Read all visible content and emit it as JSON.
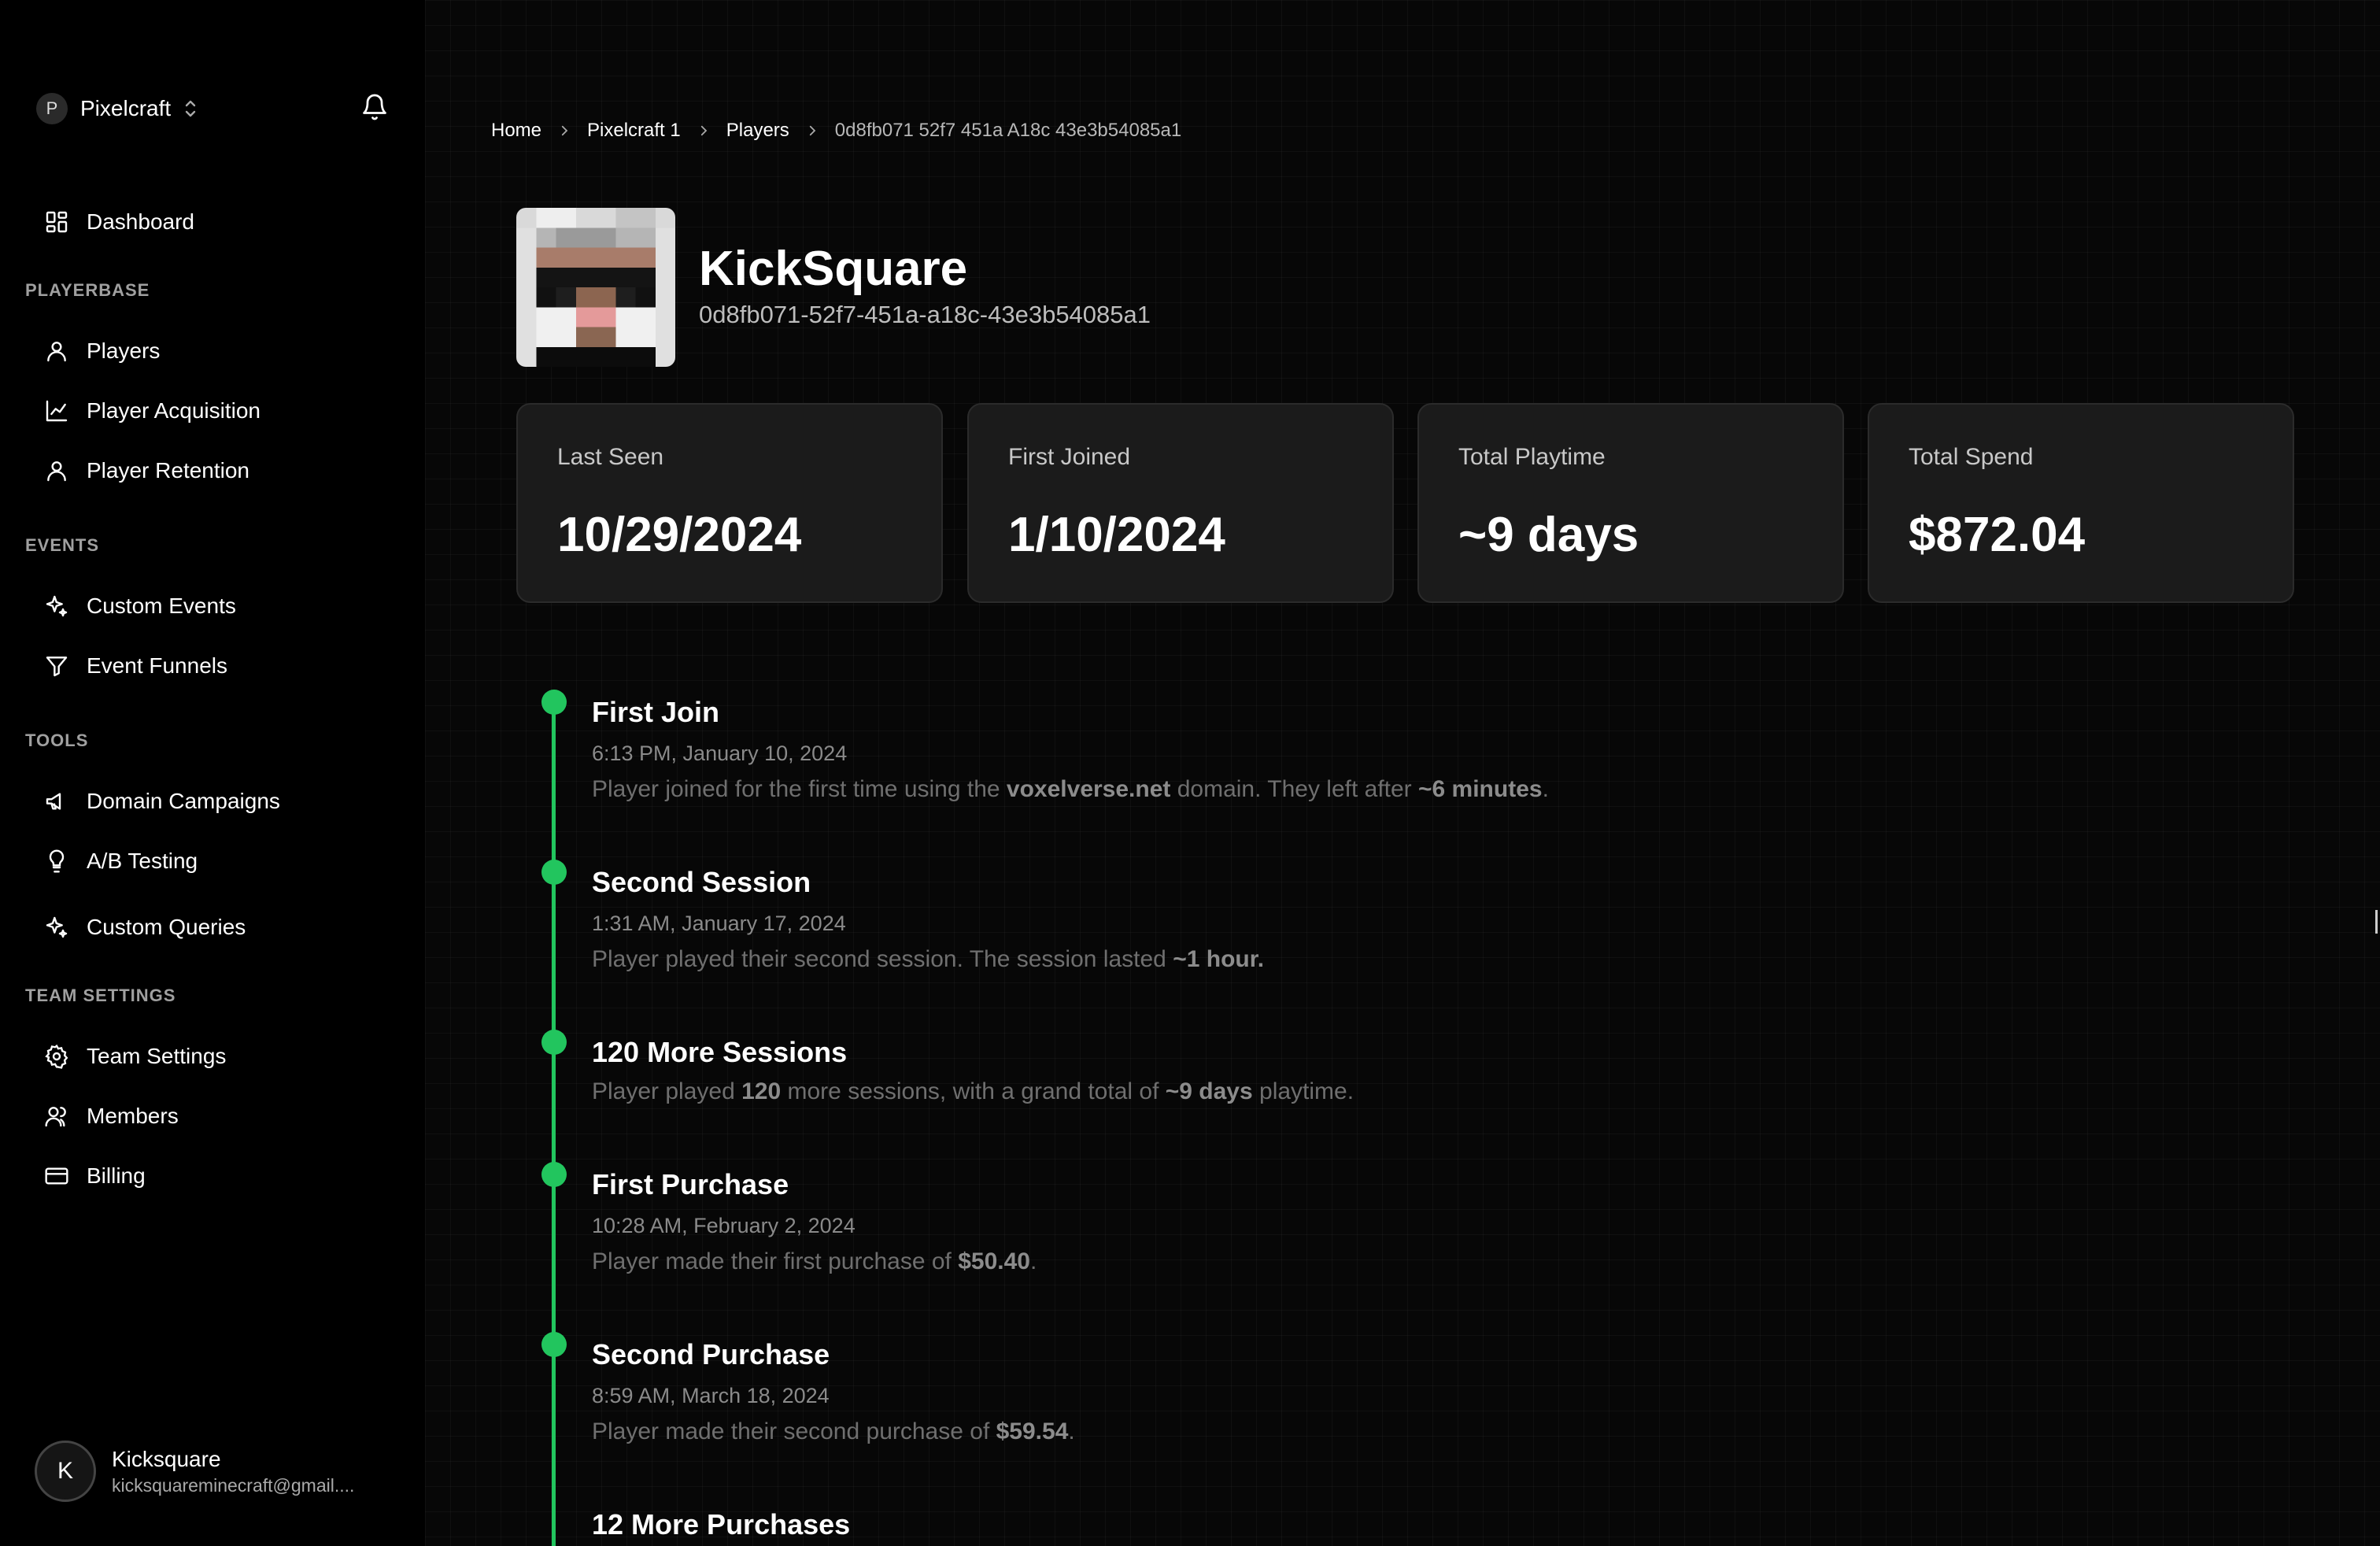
{
  "sidebar": {
    "team": {
      "initial": "P",
      "name": "Pixelcraft"
    },
    "dashboard": "Dashboard",
    "sections": {
      "playerbase": "PLAYERBASE",
      "events": "EVENTS",
      "tools": "TOOLS",
      "team_settings": "TEAM SETTINGS"
    },
    "items": {
      "players": "Players",
      "player_acquisition": "Player Acquisition",
      "player_retention": "Player Retention",
      "custom_events": "Custom Events",
      "event_funnels": "Event Funnels",
      "domain_campaigns": "Domain Campaigns",
      "ab_testing": "A/B Testing",
      "custom_queries": "Custom Queries",
      "team_settings": "Team Settings",
      "members": "Members",
      "billing": "Billing"
    },
    "user": {
      "initial": "K",
      "name": "Kicksquare",
      "email": "kicksquareminecraft@gmail...."
    }
  },
  "breadcrumb": [
    "Home",
    "Pixelcraft 1",
    "Players",
    "0d8fb071 52f7 451a A18c 43e3b54085a1"
  ],
  "player": {
    "name": "KickSquare",
    "uuid": "0d8fb071-52f7-451a-a18c-43e3b54085a1"
  },
  "stats": [
    {
      "label": "Last Seen",
      "value": "10/29/2024"
    },
    {
      "label": "First Joined",
      "value": "1/10/2024"
    },
    {
      "label": "Total Playtime",
      "value": "~9 days"
    },
    {
      "label": "Total Spend",
      "value": "$872.04"
    }
  ],
  "timeline": [
    {
      "title": "First Join",
      "time": "6:13 PM, January 10, 2024",
      "desc": [
        "Player joined for the first time using the ",
        "voxelverse.net",
        " domain. They left after ",
        "~6 minutes",
        "."
      ]
    },
    {
      "title": "Second Session",
      "time": "1:31 AM, January 17, 2024",
      "desc": [
        "Player played their second session. The session lasted ",
        "~1 hour."
      ]
    },
    {
      "title": "120 More Sessions",
      "desc": [
        "Player played ",
        "120",
        " more sessions, with a grand total of ",
        "~9 days",
        " playtime."
      ]
    },
    {
      "title": "First Purchase",
      "time": "10:28 AM, February 2, 2024",
      "desc": [
        "Player made their first purchase of ",
        "$50.40",
        "."
      ]
    },
    {
      "title": "Second Purchase",
      "time": "8:59 AM, March 18, 2024",
      "desc": [
        "Player made their second purchase of ",
        "$59.54",
        "."
      ]
    },
    {
      "title": "12 More Purchases"
    }
  ],
  "colors": {
    "accent": "#22c55e",
    "card_bg": "#1b1b1b",
    "background": "#000000"
  }
}
